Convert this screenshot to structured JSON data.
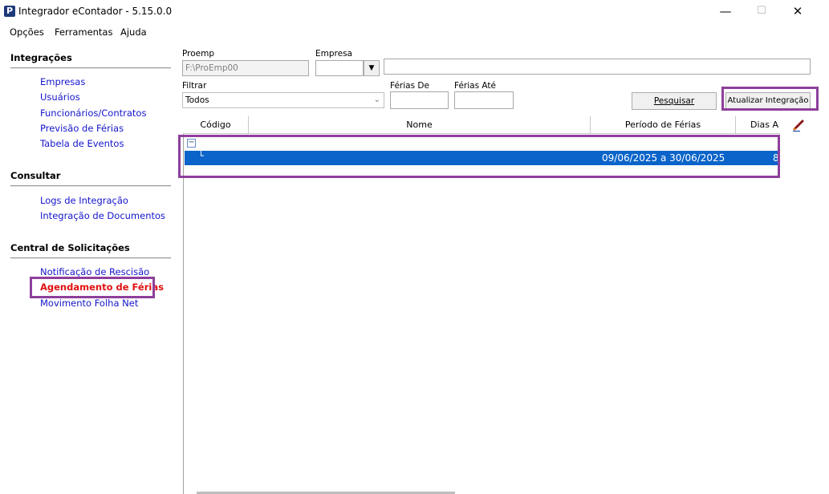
{
  "window": {
    "icon_letter": "P",
    "title": "Integrador eContador - 5.15.0.0",
    "minimize_glyph": "—",
    "maximize_glyph": "☐",
    "close_glyph": "✕"
  },
  "menu": [
    "Opções",
    "Ferramentas",
    "Ajuda"
  ],
  "sidebar": {
    "sections": [
      {
        "title": "Integrações",
        "items": [
          "Empresas",
          "Usuários",
          "Funcionários/Contratos",
          "Previsão de Férias",
          "Tabela de Eventos"
        ]
      },
      {
        "title": "Consultar",
        "items": [
          "Logs de Integração",
          "Integração de Documentos"
        ]
      },
      {
        "title": "Central de Solicitações",
        "items": [
          "Notificação de Rescisão",
          "Agendamento de Férias",
          "Movimento Folha Net"
        ]
      }
    ],
    "active_item": "Agendamento de Férias"
  },
  "form": {
    "proemp_label": "Proemp",
    "proemp_value": "F:\\ProEmp00",
    "empresa_label": "Empresa",
    "empresa_value": "",
    "empresa_dropdown_glyph": "▼",
    "empresa_name_value": "",
    "filtrar_label": "Filtrar",
    "filtrar_value": "Todos",
    "ferias_de_label": "Férias De",
    "ferias_de_value": "",
    "ferias_ate_label": "Férias Até",
    "ferias_ate_value": "",
    "pesquisar_button": "Pesquisar",
    "atualizar_button": "Atualizar Integração"
  },
  "grid": {
    "columns": [
      "Código",
      "Nome",
      "Período de Férias",
      "Dias A"
    ],
    "expand_glyph": "−",
    "tree_connector": "└",
    "rows": [
      {
        "codigo": "",
        "nome": "",
        "periodo": "09/06/2025 a 30/06/2025",
        "dias": "8",
        "selected": true
      }
    ]
  },
  "colors": {
    "highlight": "#8e3f9c",
    "link": "#1515cc",
    "active_link": "#e01010",
    "selection": "#0a64c9"
  },
  "icons": {
    "edit": "pencil-icon"
  }
}
